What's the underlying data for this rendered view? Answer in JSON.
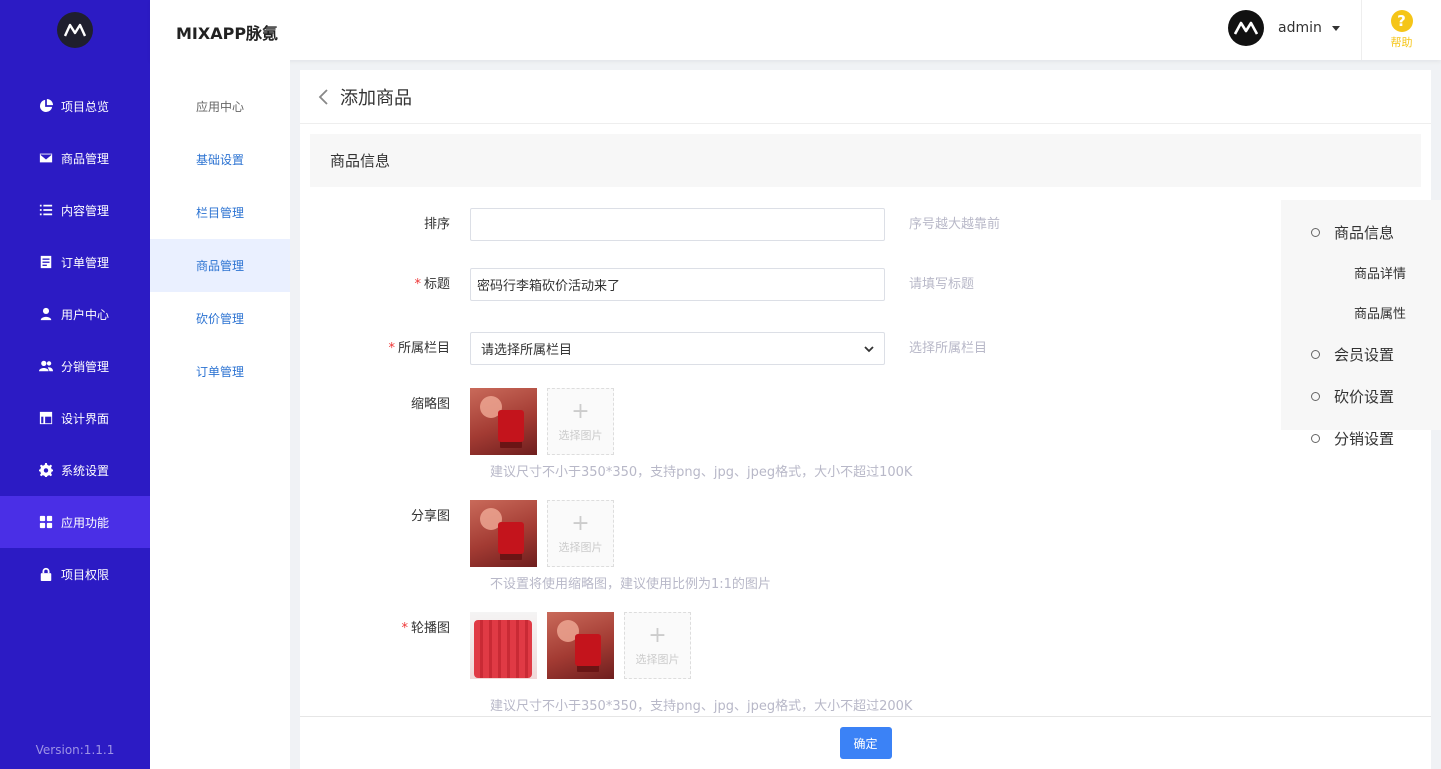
{
  "header": {
    "app_title": "MIXAPP脉氪",
    "username": "admin",
    "help_label": "帮助"
  },
  "sidebar": {
    "items": [
      {
        "label": "项目总览",
        "icon": "pie-chart-icon"
      },
      {
        "label": "商品管理",
        "icon": "envelope-icon"
      },
      {
        "label": "内容管理",
        "icon": "list-icon"
      },
      {
        "label": "订单管理",
        "icon": "document-icon"
      },
      {
        "label": "用户中心",
        "icon": "user-icon"
      },
      {
        "label": "分销管理",
        "icon": "users-icon"
      },
      {
        "label": "设计界面",
        "icon": "layout-icon"
      },
      {
        "label": "系统设置",
        "icon": "gear-icon"
      },
      {
        "label": "应用功能",
        "icon": "grid-icon",
        "active": true
      },
      {
        "label": "项目权限",
        "icon": "lock-icon"
      }
    ],
    "version": "Version:1.1.1"
  },
  "submenu": {
    "header": "应用中心",
    "items": [
      {
        "label": "基础设置"
      },
      {
        "label": "栏目管理"
      },
      {
        "label": "商品管理",
        "active": true
      },
      {
        "label": "砍价管理"
      },
      {
        "label": "订单管理"
      }
    ]
  },
  "page": {
    "title": "添加商品",
    "section_title": "商品信息"
  },
  "form": {
    "sort": {
      "label": "排序",
      "value": "",
      "hint": "序号越大越靠前"
    },
    "title": {
      "label": "标题",
      "value": "密码行李箱砍价活动来了",
      "hint": "请填写标题"
    },
    "category": {
      "label": "所属栏目",
      "value": "请选择所属栏目",
      "hint": "选择所属栏目"
    },
    "thumbnail": {
      "label": "缩略图",
      "hint": "建议尺寸不小于350*350，支持png、jpg、jpeg格式，大小不超过100K"
    },
    "share_image": {
      "label": "分享图",
      "hint": "不设置将使用缩略图，建议使用比例为1:1的图片"
    },
    "carousel": {
      "label": "轮播图",
      "hint": "建议尺寸不小于350*350，支持png、jpg、jpeg格式，大小不超过200K"
    },
    "select_image_label": "选择图片",
    "required_mark": "*"
  },
  "anchor_nav": {
    "items": [
      {
        "label": "商品信息"
      },
      {
        "label": "商品详情"
      },
      {
        "label": "商品属性"
      },
      {
        "label": "会员设置"
      },
      {
        "label": "砍价设置"
      },
      {
        "label": "分销设置"
      }
    ]
  },
  "footer": {
    "confirm_label": "确定"
  },
  "colors": {
    "sidebar_bg": "#2c1bc4",
    "sidebar_active": "#4a2fe6",
    "link": "#2c73d2",
    "primary": "#3b82f6",
    "help": "#f5c518"
  }
}
